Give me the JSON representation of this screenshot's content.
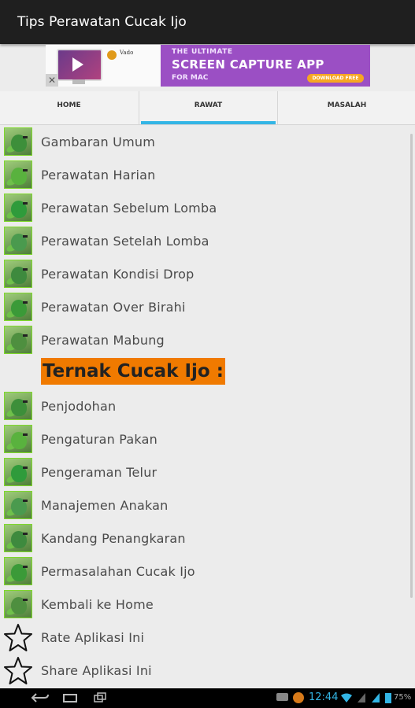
{
  "app": {
    "title": "Tips Perawatan Cucak Ijo"
  },
  "ad": {
    "brand_text": "Vado",
    "line1": "THE ULTIMATE",
    "line2": "SCREEN CAPTURE APP",
    "line3": "FOR MAC",
    "cta": "DOWNLOAD FREE",
    "close": "✕"
  },
  "tabs": [
    {
      "label": "HOME",
      "selected": false
    },
    {
      "label": "RAWAT",
      "selected": true
    },
    {
      "label": "MASALAH",
      "selected": false
    }
  ],
  "menu": [
    {
      "label": "Gambaran Umum",
      "icon": "bird-thumbnail-icon"
    },
    {
      "label": "Perawatan Harian",
      "icon": "bird-thumbnail-icon"
    },
    {
      "label": "Perawatan Sebelum Lomba",
      "icon": "bird-thumbnail-icon"
    },
    {
      "label": "Perawatan Setelah Lomba",
      "icon": "bird-thumbnail-icon"
    },
    {
      "label": "Perawatan Kondisi Drop",
      "icon": "bird-thumbnail-icon"
    },
    {
      "label": "Perawatan Over Birahi",
      "icon": "bird-thumbnail-icon"
    },
    {
      "label": "Perawatan Mabung",
      "icon": "bird-thumbnail-icon"
    }
  ],
  "section_header": "Ternak Cucak Ijo :",
  "menu2": [
    {
      "label": "Penjodohan",
      "icon": "bird-thumbnail-icon"
    },
    {
      "label": "Pengaturan Pakan",
      "icon": "bird-thumbnail-icon"
    },
    {
      "label": "Pengeraman Telur",
      "icon": "bird-thumbnail-icon"
    },
    {
      "label": "Manajemen Anakan",
      "icon": "bird-thumbnail-icon"
    },
    {
      "label": "Kandang Penangkaran",
      "icon": "bird-thumbnail-icon"
    },
    {
      "label": "Permasalahan Cucak Ijo",
      "icon": "bird-thumbnail-icon"
    },
    {
      "label": "Kembali ke Home",
      "icon": "bird-thumbnail-icon"
    },
    {
      "label": "Rate Aplikasi Ini",
      "icon": "star-icon"
    },
    {
      "label": "Share Aplikasi Ini",
      "icon": "star-icon"
    }
  ],
  "status": {
    "time": "12:44",
    "battery": "75%"
  },
  "colors": {
    "accent": "#33b5e5",
    "section_bg": "#f07a00",
    "titlebar": "#1f1f1f"
  }
}
